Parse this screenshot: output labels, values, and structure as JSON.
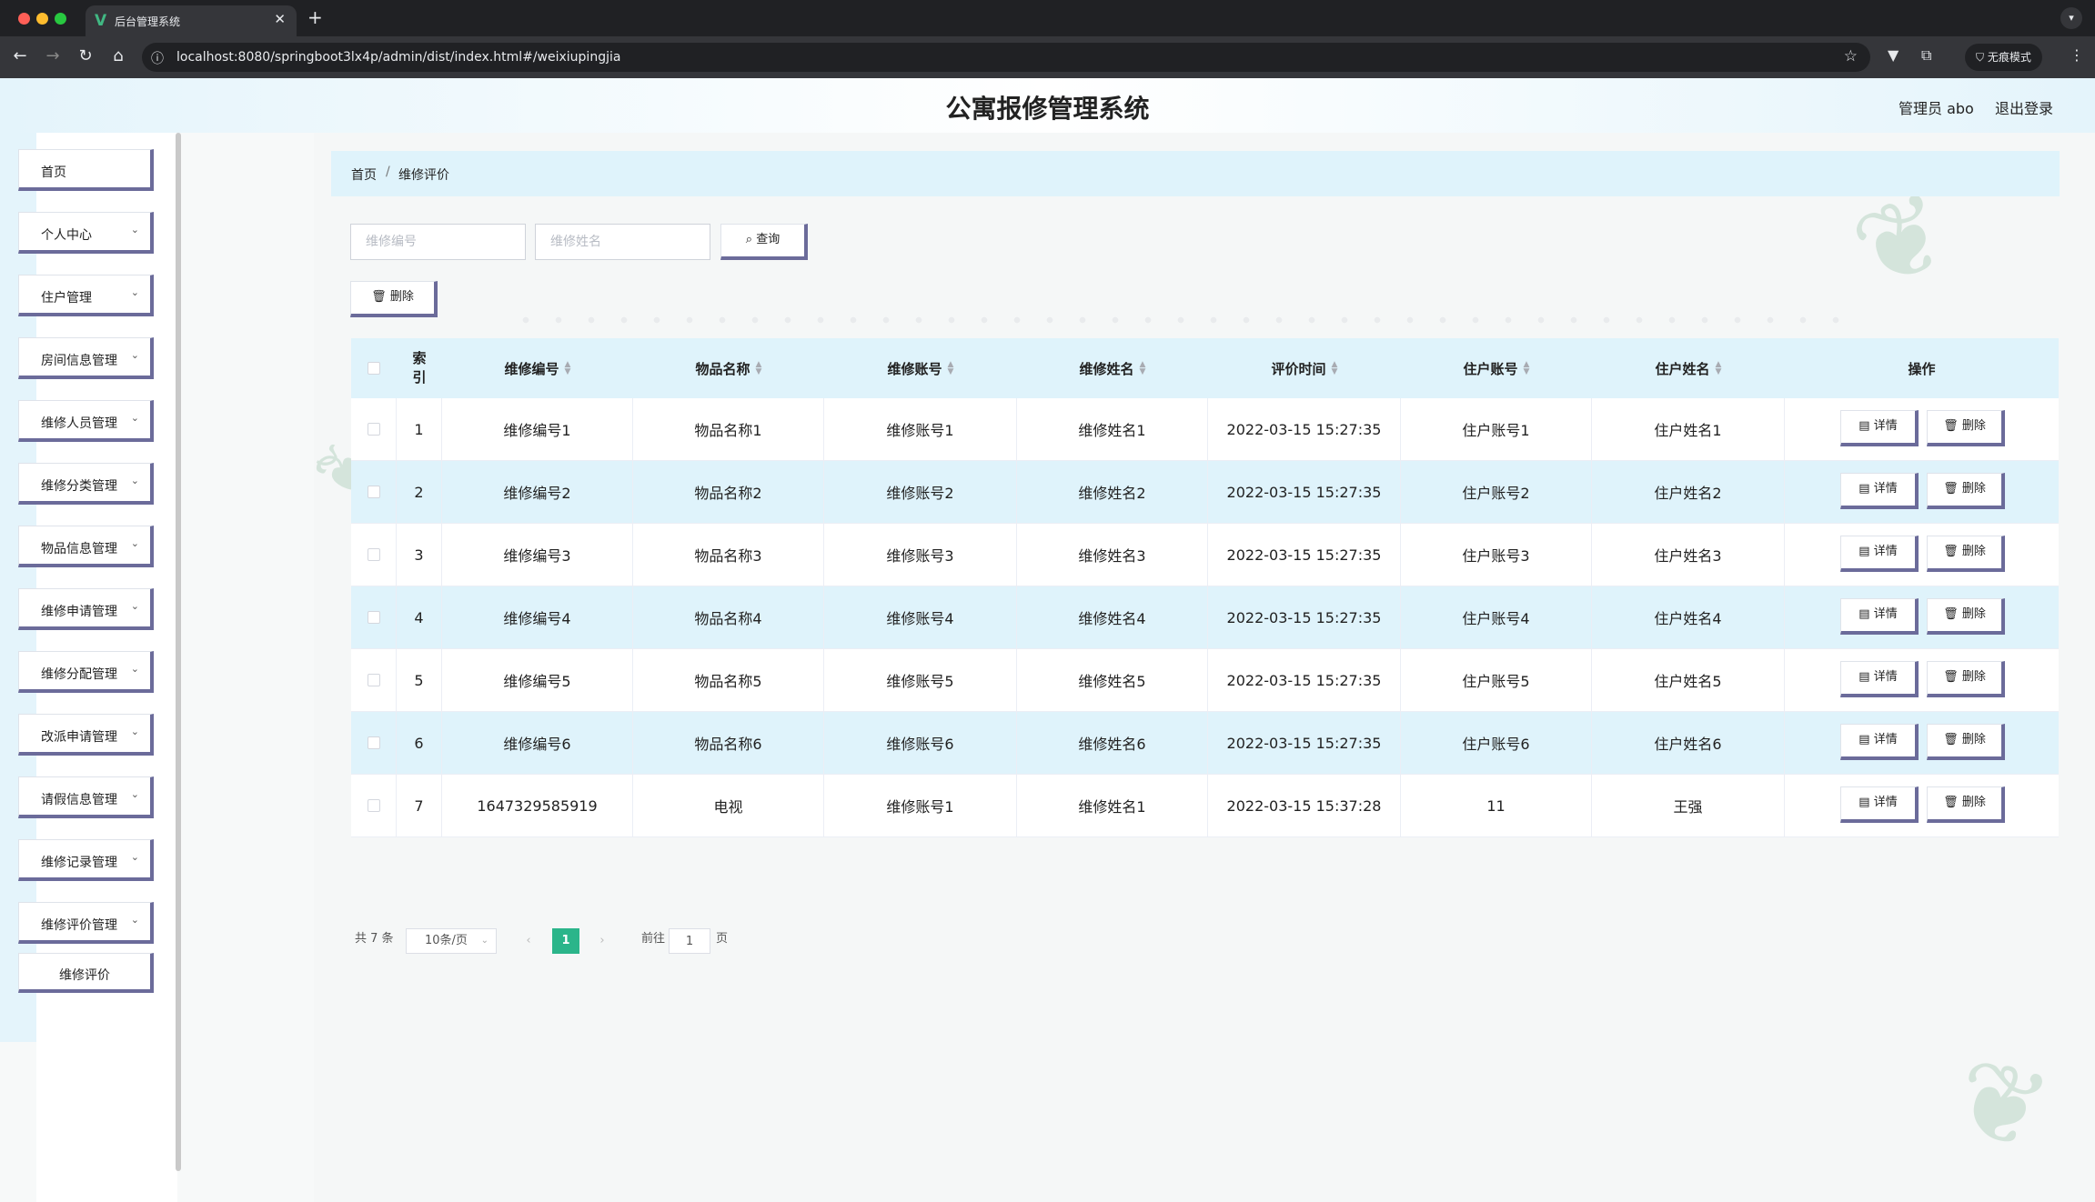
{
  "browser": {
    "tab_title": "后台管理系统",
    "url": "localhost:8080/springboot3lx4p/admin/dist/index.html#/weixiupingjia",
    "incognito_label": "无痕模式"
  },
  "header": {
    "title": "公寓报修管理系统",
    "user": "管理员 abo",
    "logout": "退出登录"
  },
  "sidebar": {
    "items": [
      {
        "label": "首页",
        "has_arrow": false
      },
      {
        "label": "个人中心",
        "has_arrow": true
      },
      {
        "label": "住户管理",
        "has_arrow": true
      },
      {
        "label": "房间信息管理",
        "has_arrow": true
      },
      {
        "label": "维修人员管理",
        "has_arrow": true
      },
      {
        "label": "维修分类管理",
        "has_arrow": true
      },
      {
        "label": "物品信息管理",
        "has_arrow": true
      },
      {
        "label": "维修申请管理",
        "has_arrow": true
      },
      {
        "label": "维修分配管理",
        "has_arrow": true
      },
      {
        "label": "改派申请管理",
        "has_arrow": true
      },
      {
        "label": "请假信息管理",
        "has_arrow": true
      },
      {
        "label": "维修记录管理",
        "has_arrow": true
      },
      {
        "label": "维修评价管理",
        "has_arrow": true
      }
    ],
    "submenu_item": "维修评价"
  },
  "breadcrumb": {
    "home": "首页",
    "separator": "/",
    "current": "维修评价"
  },
  "search": {
    "field1_placeholder": "维修编号",
    "field2_placeholder": "维修姓名",
    "query_label": "查询",
    "batch_delete_label": "删除"
  },
  "table": {
    "columns": [
      "索引",
      "维修编号",
      "物品名称",
      "维修账号",
      "维修姓名",
      "评价时间",
      "住户账号",
      "住户姓名",
      "操作"
    ],
    "rows": [
      {
        "index": "1",
        "weixiubianhao": "维修编号1",
        "wupinmingcheng": "物品名称1",
        "weixiuzhanghao": "维修账号1",
        "weixiuxingming": "维修姓名1",
        "pingjiashijian": "2022-03-15 15:27:35",
        "zhuhuzhanghao": "住户账号1",
        "zhuhuxingming": "住户姓名1"
      },
      {
        "index": "2",
        "weixiubianhao": "维修编号2",
        "wupinmingcheng": "物品名称2",
        "weixiuzhanghao": "维修账号2",
        "weixiuxingming": "维修姓名2",
        "pingjiashijian": "2022-03-15 15:27:35",
        "zhuhuzhanghao": "住户账号2",
        "zhuhuxingming": "住户姓名2"
      },
      {
        "index": "3",
        "weixiubianhao": "维修编号3",
        "wupinmingcheng": "物品名称3",
        "weixiuzhanghao": "维修账号3",
        "weixiuxingming": "维修姓名3",
        "pingjiashijian": "2022-03-15 15:27:35",
        "zhuhuzhanghao": "住户账号3",
        "zhuhuxingming": "住户姓名3"
      },
      {
        "index": "4",
        "weixiubianhao": "维修编号4",
        "wupinmingcheng": "物品名称4",
        "weixiuzhanghao": "维修账号4",
        "weixiuxingming": "维修姓名4",
        "pingjiashijian": "2022-03-15 15:27:35",
        "zhuhuzhanghao": "住户账号4",
        "zhuhuxingming": "住户姓名4"
      },
      {
        "index": "5",
        "weixiubianhao": "维修编号5",
        "wupinmingcheng": "物品名称5",
        "weixiuzhanghao": "维修账号5",
        "weixiuxingming": "维修姓名5",
        "pingjiashijian": "2022-03-15 15:27:35",
        "zhuhuzhanghao": "住户账号5",
        "zhuhuxingming": "住户姓名5"
      },
      {
        "index": "6",
        "weixiubianhao": "维修编号6",
        "wupinmingcheng": "物品名称6",
        "weixiuzhanghao": "维修账号6",
        "weixiuxingming": "维修姓名6",
        "pingjiashijian": "2022-03-15 15:27:35",
        "zhuhuzhanghao": "住户账号6",
        "zhuhuxingming": "住户姓名6"
      },
      {
        "index": "7",
        "weixiubianhao": "1647329585919",
        "wupinmingcheng": "电视",
        "weixiuzhanghao": "维修账号1",
        "weixiuxingming": "维修姓名1",
        "pingjiashijian": "2022-03-15 15:37:28",
        "zhuhuzhanghao": "11",
        "zhuhuxingming": "王强"
      }
    ],
    "detail_label": "详情",
    "delete_label": "删除"
  },
  "pagination": {
    "total": "共 7 条",
    "page_size": "10条/页",
    "current_page": "1",
    "goto_prefix": "前往",
    "goto_value": "1",
    "goto_suffix": "页"
  },
  "colors": {
    "accent_header": "#dff3fb",
    "button_shadow": "#6b6b9a",
    "pagination_active": "#2bb58a"
  },
  "icons": [
    "search-icon",
    "trash-icon",
    "document-icon",
    "chevron-down-icon",
    "chevron-left-icon",
    "chevron-right-icon"
  ]
}
